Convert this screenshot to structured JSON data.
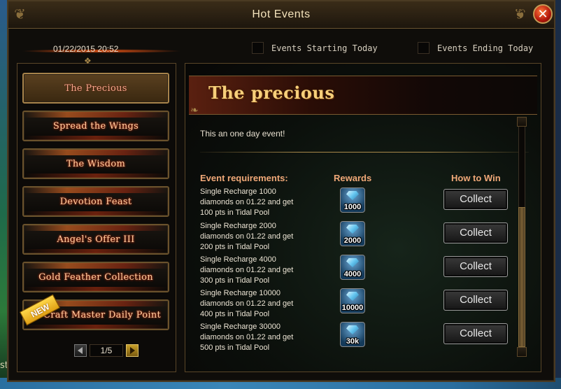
{
  "window": {
    "title": "Hot Events",
    "close_glyph": "✕"
  },
  "topbar": {
    "datetime": "01/22/2015 20:52",
    "filter_start_label": "Events Starting Today",
    "filter_end_label": "Events Ending Today",
    "filter_start_checked": false,
    "filter_end_checked": false
  },
  "sidebar": {
    "items": [
      {
        "label": "The Precious",
        "active": true
      },
      {
        "label": "Spread the Wings",
        "active": false
      },
      {
        "label": "The Wisdom",
        "active": false
      },
      {
        "label": "Devotion Feast",
        "active": false
      },
      {
        "label": "Angel's Offer III",
        "active": false
      },
      {
        "label": "Gold Feather Collection",
        "active": false
      },
      {
        "label": "Craft Master Daily Point",
        "active": false,
        "badge": "NEW"
      }
    ],
    "pager": {
      "current": "1/5"
    }
  },
  "event": {
    "title": "The precious",
    "description": "This an one day event!",
    "headers": {
      "requirements": "Event requirements:",
      "rewards": "Rewards",
      "how_to_win": "How to Win"
    },
    "rows": [
      {
        "requirement": "Single Recharge 1000\ndiamonds on 01.22 and get\n100 pts in Tidal Pool",
        "reward": "1000",
        "button": "Collect"
      },
      {
        "requirement": "Single Recharge 2000\ndiamonds on 01.22 and get\n200 pts in Tidal Pool",
        "reward": "2000",
        "button": "Collect"
      },
      {
        "requirement": "Single Recharge 4000\ndiamonds on 01.22 and get\n300 pts in Tidal Pool",
        "reward": "4000",
        "button": "Collect"
      },
      {
        "requirement": "Single Recharge 10000\ndiamonds on 01.22 and get\n400 pts in Tidal Pool",
        "reward": "10000",
        "button": "Collect"
      },
      {
        "requirement": "Single Recharge 30000\ndiamonds on 01.22 and get\n500 pts in Tidal Pool",
        "reward": "30k",
        "button": "Collect"
      }
    ]
  },
  "background": {
    "left_clip_text": "st"
  },
  "colors": {
    "accent": "#f7cf7a",
    "menu_text": "#ffcfa0",
    "header_text": "#f0a878"
  }
}
